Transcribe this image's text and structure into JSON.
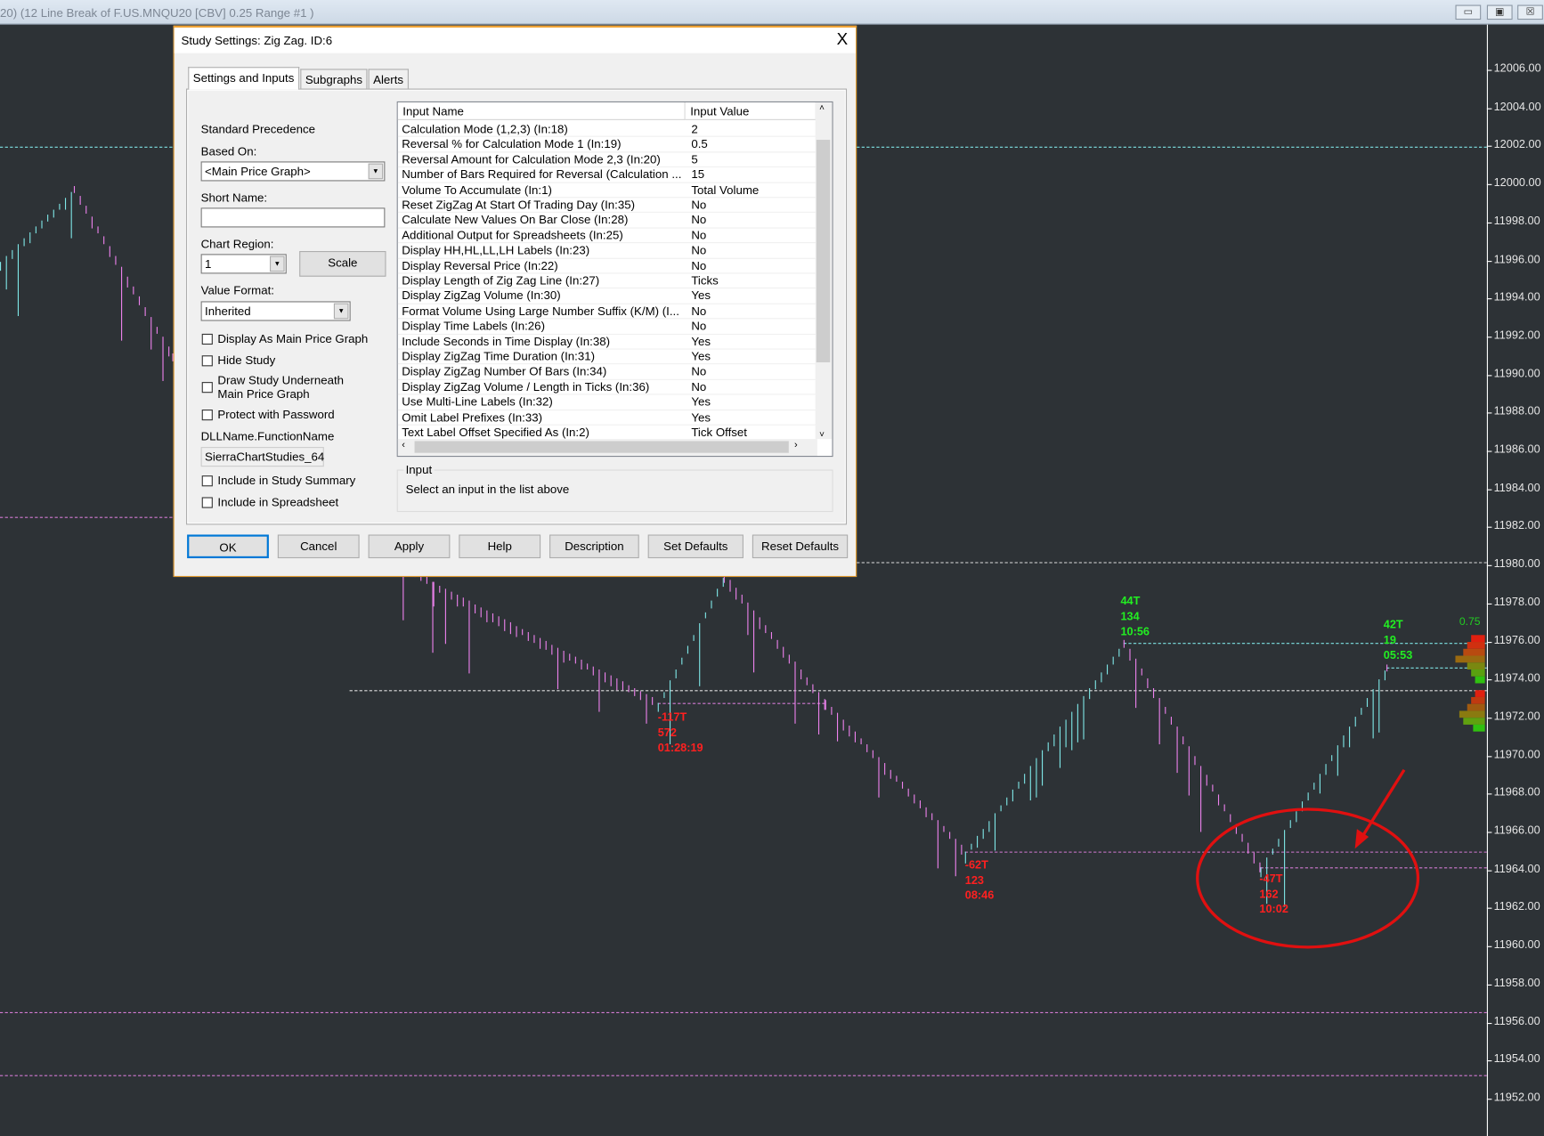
{
  "window": {
    "title": "20) (12 Line Break of F.US.MNQU20 [CBV]  0.25 Range  #1 )",
    "min": "▭",
    "max": "▣",
    "close": "☒"
  },
  "chart_data": {
    "type": "line",
    "title": "12 Line Break of F.US.MNQU20 [CBV] 0.25 Range",
    "ylim": [
      11951,
      12008
    ],
    "y_ticks": [
      "12006.00",
      "12004.00",
      "12002.00",
      "12000.00",
      "11998.00",
      "11996.00",
      "11994.00",
      "11992.00",
      "11990.00",
      "11988.00",
      "11986.00",
      "11984.00",
      "11982.00",
      "11980.00",
      "11978.00",
      "11976.00",
      "11974.00",
      "11972.00",
      "11970.00",
      "11968.00",
      "11966.00",
      "11964.00",
      "11962.00",
      "11960.00",
      "11958.00",
      "11956.00",
      "11954.00",
      "11952.00"
    ],
    "pivots": [
      [
        0,
        11996
      ],
      [
        75,
        11999.8
      ],
      [
        175,
        11991
      ],
      [
        440,
        11979
      ],
      [
        668,
        11972.8
      ],
      [
        735,
        11979.5
      ],
      [
        838,
        11972.8
      ],
      [
        980,
        11965.0
      ],
      [
        1141,
        11976.0
      ],
      [
        1280,
        11964.2
      ],
      [
        1408,
        11974.7
      ],
      [
        1412,
        11971.8
      ]
    ],
    "zigzag_labels": [
      {
        "lines": [
          "-117T",
          "572",
          "01:28:19"
        ],
        "color": "#ff2020"
      },
      {
        "lines": [
          "-62T",
          "123",
          "08:46"
        ],
        "color": "#ff2020"
      },
      {
        "lines": [
          "44T",
          "134",
          "10:56"
        ],
        "color": "#22ee22"
      },
      {
        "lines": [
          "-47T",
          "162",
          "10:02"
        ],
        "color": "#ff2020"
      },
      {
        "lines": [
          "42T",
          "19",
          "05:53"
        ],
        "color": "#22ee22"
      }
    ],
    "range_label": "0.75",
    "level_lines": [
      12002.0,
      11982.6,
      11980.2,
      11973.5,
      11976.0,
      11974.7,
      11972.8,
      11965.0,
      11964.2,
      11956.6,
      11953.3
    ]
  },
  "dialog": {
    "title": "Study Settings: Zig Zag. ID:6",
    "close": "X",
    "tabs": [
      "Settings and Inputs",
      "Subgraphs",
      "Alerts"
    ],
    "left": {
      "precedence": "Standard Precedence",
      "based_on_label": "Based On:",
      "based_on_value": "<Main Price Graph>",
      "short_name_label": "Short Name:",
      "short_name_value": "",
      "chart_region_label": "Chart Region:",
      "chart_region_value": "1",
      "scale_button": "Scale",
      "value_format_label": "Value Format:",
      "value_format_value": "Inherited",
      "checkboxes": [
        "Display As Main Price Graph",
        "Hide Study",
        "Draw Study Underneath",
        "Main Price Graph",
        "Protect with Password"
      ],
      "dll_label": "DLLName.FunctionName",
      "dll_value": "SierraChartStudies_64",
      "checkboxes2": [
        "Include in Study Summary",
        "Include in Spreadsheet"
      ]
    },
    "list": {
      "headers": [
        "Input Name",
        "Input Value"
      ],
      "rows": [
        [
          "Calculation Mode (1,2,3)   (In:18)",
          "2"
        ],
        [
          "Reversal % for Calculation Mode 1   (In:19)",
          "0.5"
        ],
        [
          "Reversal Amount for Calculation Mode 2,3   (In:20)",
          "5"
        ],
        [
          "Number of Bars Required for Reversal (Calculation ...",
          "15"
        ],
        [
          "Volume To Accumulate   (In:1)",
          "Total Volume"
        ],
        [
          "Reset ZigZag At Start Of Trading Day   (In:35)",
          "No"
        ],
        [
          "Calculate New Values On Bar Close   (In:28)",
          "No"
        ],
        [
          "Additional Output for Spreadsheets   (In:25)",
          "No"
        ],
        [
          "Display HH,HL,LL,LH Labels   (In:23)",
          "No"
        ],
        [
          "Display Reversal Price   (In:22)",
          "No"
        ],
        [
          "Display Length of Zig Zag Line   (In:27)",
          "Ticks"
        ],
        [
          "Display ZigZag Volume   (In:30)",
          "Yes"
        ],
        [
          "Format Volume Using Large Number Suffix (K/M)   (I...",
          "No"
        ],
        [
          "Display Time Labels   (In:26)",
          "No"
        ],
        [
          "Include Seconds in Time Display   (In:38)",
          "Yes"
        ],
        [
          "Display ZigZag Time Duration   (In:31)",
          "Yes"
        ],
        [
          "Display ZigZag Number Of Bars   (In:34)",
          "No"
        ],
        [
          "Display ZigZag Volume / Length in Ticks   (In:36)",
          "No"
        ],
        [
          "Use Multi-Line Labels   (In:32)",
          "Yes"
        ],
        [
          "Omit Label Prefixes   (In:33)",
          "Yes"
        ],
        [
          "Text Label Offset Specified As   (In:2)",
          "Tick Offset"
        ]
      ]
    },
    "input_group": {
      "label": "Input",
      "text": "Select an input in the list above"
    },
    "buttons": [
      "OK",
      "Cancel",
      "Apply",
      "Help",
      "Description",
      "Set Defaults",
      "Reset Defaults"
    ]
  }
}
